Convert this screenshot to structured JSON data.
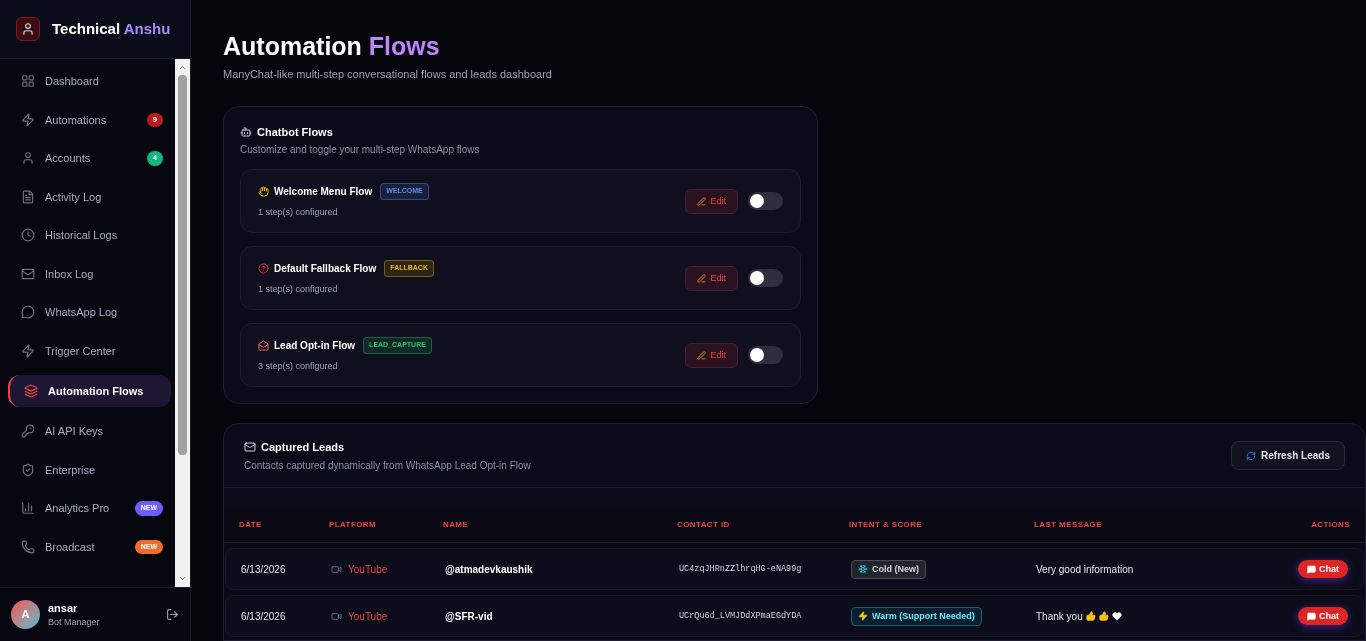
{
  "brand": {
    "first": "Technical",
    "second": "Anshu"
  },
  "sidebar": {
    "items": [
      {
        "label": "Dashboard",
        "selected": false
      },
      {
        "label": "Automations",
        "selected": false,
        "badge": "9",
        "color": "#b91c1c"
      },
      {
        "label": "Accounts",
        "selected": false,
        "badge": "4",
        "color": "#10b981"
      },
      {
        "label": "Activity Log",
        "selected": false
      },
      {
        "label": "Historical Logs",
        "selected": false
      },
      {
        "label": "Inbox Log",
        "selected": false
      },
      {
        "label": "WhatsApp Log",
        "selected": false
      },
      {
        "label": "Trigger Center",
        "selected": false
      },
      {
        "label": "Automation Flows",
        "selected": true
      },
      {
        "label": "AI API Keys",
        "selected": false
      },
      {
        "label": "Enterprise",
        "selected": false
      },
      {
        "label": "Analytics Pro",
        "selected": false,
        "badge": "NEW",
        "color": "#6d5dfc"
      },
      {
        "label": "Broadcast",
        "selected": false,
        "badge": "NEW",
        "color": "#f26b2a"
      }
    ]
  },
  "user": {
    "initial": "A",
    "name": "ansar",
    "role": "Bot Manager"
  },
  "page": {
    "title_first": "Automation",
    "title_second": "Flows",
    "subtitle": "ManyChat-like multi-step conversational flows and leads dashboard"
  },
  "flows_card": {
    "title": "Chatbot Flows",
    "subtitle": "Customize and toggle your multi-step WhatsApp flows",
    "flows": [
      {
        "name": "Welcome Menu Flow",
        "tag": "WELCOME",
        "color": "#5b8def",
        "steps": "1 step(s) configured",
        "edit": "Edit",
        "on": false
      },
      {
        "name": "Default Fallback Flow",
        "tag": "FALLBACK",
        "color": "#eab308",
        "steps": "1 step(s) configured",
        "edit": "Edit",
        "on": false
      },
      {
        "name": "Lead Opt-in Flow",
        "tag": "LEAD_CAPTURE",
        "color": "#22c55e",
        "steps": "3 step(s) configured",
        "edit": "Edit",
        "on": false
      }
    ]
  },
  "leads_card": {
    "title": "Captured Leads",
    "subtitle": "Contacts captured dynamically from WhatsApp Lead Opt-in Flow",
    "refresh": "Refresh Leads",
    "table": {
      "columns": [
        "DATE",
        "PLATFORM",
        "NAME",
        "CONTACT ID",
        "INTENT & SCORE",
        "LAST MESSAGE",
        "ACTIONS"
      ],
      "rows": [
        {
          "date": "6/13/2026",
          "platform": "YouTube",
          "name": "@atmadevkaushik",
          "contact_id": "UC4zqJHRnZZlhrqHG-eNA99g",
          "intent": "Cold (New)",
          "kind": "cold",
          "message": "Very good information",
          "action": "Chat"
        },
        {
          "date": "6/13/2026",
          "platform": "YouTube",
          "name": "@SFR-vid",
          "contact_id": "UCrQu6d_LVMJDdXPmaEGdYDA",
          "intent": "Warm (Support Needed)",
          "kind": "warm",
          "message": "Thank you",
          "action": "Chat"
        }
      ]
    }
  }
}
